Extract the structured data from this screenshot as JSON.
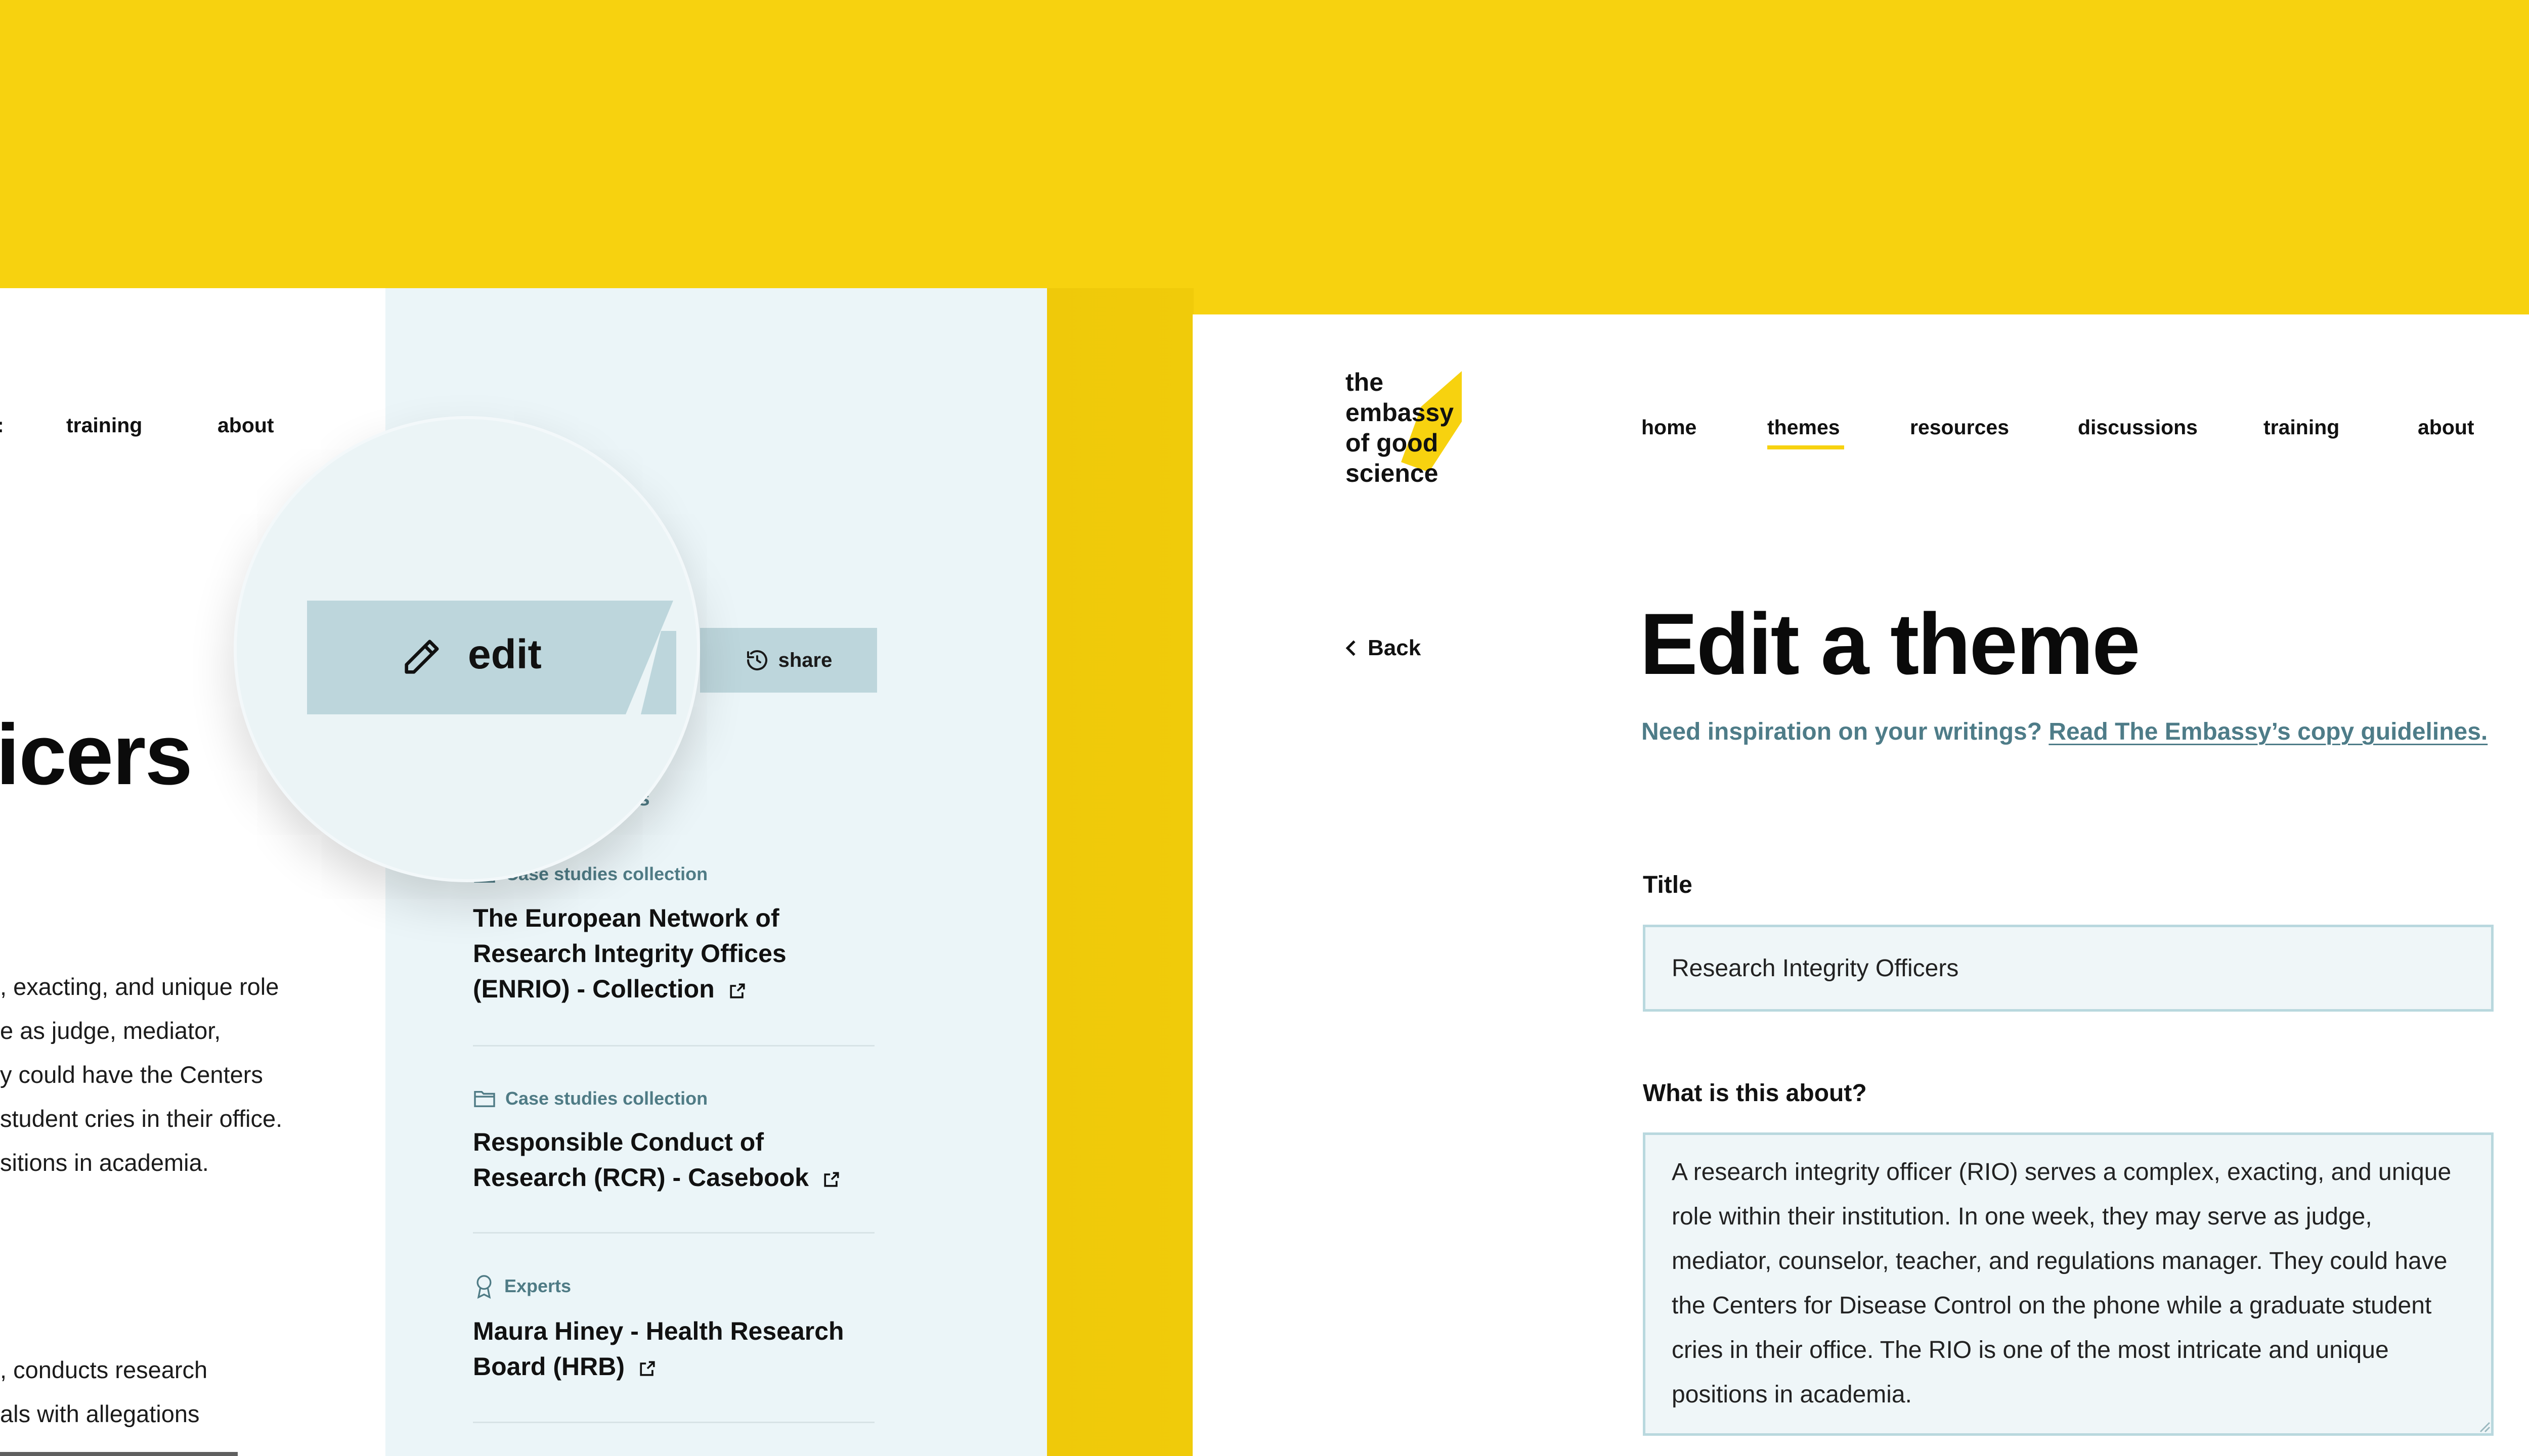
{
  "colors": {
    "brand_yellow": "#F7D20F",
    "sidebar_bg": "#EBF5F8",
    "accent_teal": "#4E7C88",
    "button_bg": "#BDD6DC",
    "input_border": "#B9D8DE"
  },
  "left_page": {
    "nav": {
      "partial": ":",
      "training": "training",
      "about": "about"
    },
    "heading_fragment": "icers",
    "paragraph_lines": [
      ", exacting, and unique role",
      "e as judge, mediator,",
      "y could have the Centers",
      "student cries in their office.",
      "sitions in academia."
    ],
    "paragraph2_lines": [
      ", conducts research",
      "als with allegations"
    ]
  },
  "sidebar": {
    "section_label_fragment": "es",
    "share_label": "share",
    "items": [
      {
        "meta": "Case studies collection",
        "title": "The European Network of Research Integrity Offices (ENRIO) - Collection",
        "icon": "folder-icon"
      },
      {
        "meta": "Case studies collection",
        "title": "Responsible Conduct of Research (RCR) - Casebook",
        "icon": "folder-icon"
      },
      {
        "meta": "Experts",
        "title": "Maura Hiney - Health Research Board (HRB)",
        "icon": "expert-badge-icon"
      }
    ]
  },
  "magnifier": {
    "edit_label": "edit",
    "share_fragment": "s"
  },
  "right_page": {
    "logo_lines": [
      "the",
      "embassy",
      "of good",
      "science"
    ],
    "nav": [
      {
        "label": "home",
        "active": false
      },
      {
        "label": "themes",
        "active": true
      },
      {
        "label": "resources",
        "active": false
      },
      {
        "label": "discussions",
        "active": false
      },
      {
        "label": "training",
        "active": false
      },
      {
        "label": "about",
        "active": false
      }
    ],
    "back_label": "Back",
    "title": "Edit a theme",
    "inspiration_prefix": "Need inspiration on your writings?",
    "inspiration_link": "Read The Embassy’s copy guidelines.",
    "form": {
      "title_label": "Title",
      "title_value": "Research Integrity Officers",
      "about_label": "What is this about?",
      "about_value": "A research integrity officer (RIO) serves a complex, exacting, and unique role within their institution. In one week, they may serve as judge, mediator, counselor, teacher, and regulations manager. They could have the Centers for Disease Control on the phone while a graduate student cries in their office. The RIO is one of the most intricate and unique positions in academia."
    }
  }
}
